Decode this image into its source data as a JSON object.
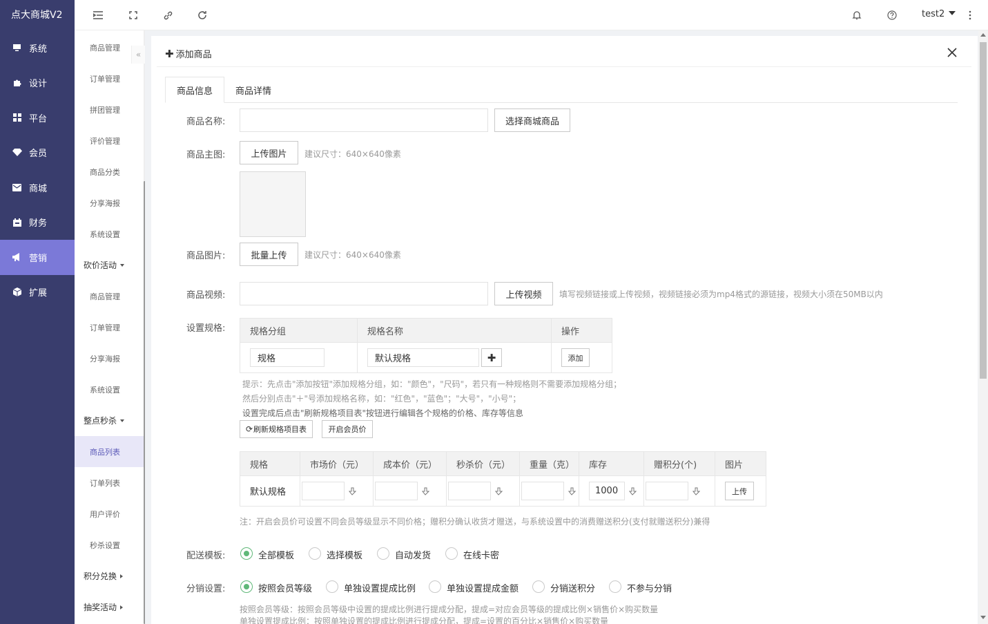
{
  "app": {
    "title": "点大商城V2"
  },
  "nav": {
    "items": [
      {
        "label": "系统",
        "icon": "monitor-icon"
      },
      {
        "label": "设计",
        "icon": "puzzle-icon"
      },
      {
        "label": "平台",
        "icon": "grid-icon"
      },
      {
        "label": "会员",
        "icon": "diamond-icon"
      },
      {
        "label": "商城",
        "icon": "mail-icon"
      },
      {
        "label": "财务",
        "icon": "calendar-icon"
      },
      {
        "label": "营销",
        "icon": "megaphone-icon",
        "active": true
      },
      {
        "label": "扩展",
        "icon": "cube-icon"
      }
    ]
  },
  "subnav": {
    "items": [
      "商品管理",
      "订单管理",
      "拼团管理",
      "评价管理",
      "商品分类",
      "分享海报",
      "系统设置"
    ],
    "group_kanjia": "砍价活动",
    "kanjia_items": [
      "商品管理",
      "订单管理",
      "分享海报",
      "系统设置"
    ],
    "group_miaosha": "整点秒杀",
    "miaosha_items": [
      "商品列表",
      "订单列表",
      "用户评价",
      "秒杀设置"
    ],
    "group_jifen": "积分兑换",
    "group_choujiang": "抽奖活动"
  },
  "topbar": {
    "user": "test2"
  },
  "panel": {
    "title": "添加商品",
    "tabs": [
      "商品信息",
      "商品详情"
    ],
    "form": {
      "name_label": "商品名称:",
      "name_value": "",
      "choose_btn": "选择商城商品",
      "main_pic_label": "商品主图:",
      "upload_btn": "上传图片",
      "size_hint": "建议尺寸：640×640像素",
      "pics_label": "商品图片:",
      "batch_btn": "批量上传",
      "pics_hint": "建议尺寸：640×640像素",
      "video_label": "商品视频:",
      "video_btn": "上传视频",
      "video_hint": "填写视频链接或上传视频，视频链接必须为mp4格式的源链接，视频大小须在50MB以内",
      "spec_label": "设置规格:",
      "spec_head": [
        "规格分组",
        "规格名称",
        "操作"
      ],
      "spec_group_value": "规格",
      "spec_name_value": "默认规格",
      "spec_add_btn": "添加",
      "tips": [
        "提示：先点击\"添加按钮\"添加规格分组，如：\"颜色\"，\"尺码\"，若只有一种规格则不需要添加规格分组；",
        "然后分别点击\"＋\"号添加规格名称，如：\"红色\"，\"蓝色\"；\"大号\"，\"小号\"；",
        "设置完成后点击\"刷新规格项目表\"按钮进行编辑各个规格的价格、库存等信息"
      ],
      "refresh_btn": "刷新规格项目表",
      "member_btn": "开启会员价",
      "price_head": [
        "规格",
        "市场价（元）",
        "成本价（元）",
        "秒杀价（元）",
        "重量（克）",
        "库存",
        "赠积分(个)",
        "图片"
      ],
      "price_row": {
        "spec": "默认规格",
        "stock": "1000",
        "upload": "上传"
      },
      "note": "注：开启会员价可设置不同会员等级显示不同价格；赠积分确认收货才赠送，与系统设置中的消费赠送积分(支付就赠送积分)兼得",
      "delivery_label": "配送模板:",
      "delivery_options": [
        "全部模板",
        "选择模板",
        "自动发货",
        "在线卡密"
      ],
      "fenxiao_label": "分销设置:",
      "fenxiao_options": [
        "按照会员等级",
        "单独设置提成比例",
        "单独设置提成金额",
        "分销送积分",
        "不参与分销"
      ],
      "fenxiao_desc": [
        "按照会员等级：按照会员等级中设置的提成比例进行提成分配，提成=对应会员等级的提成比例×销售价×购买数量",
        "单独设置提成比例：按照单独设置的提成比例进行提成分配，提成=设置的百分比×销售价×购买数量"
      ]
    }
  }
}
